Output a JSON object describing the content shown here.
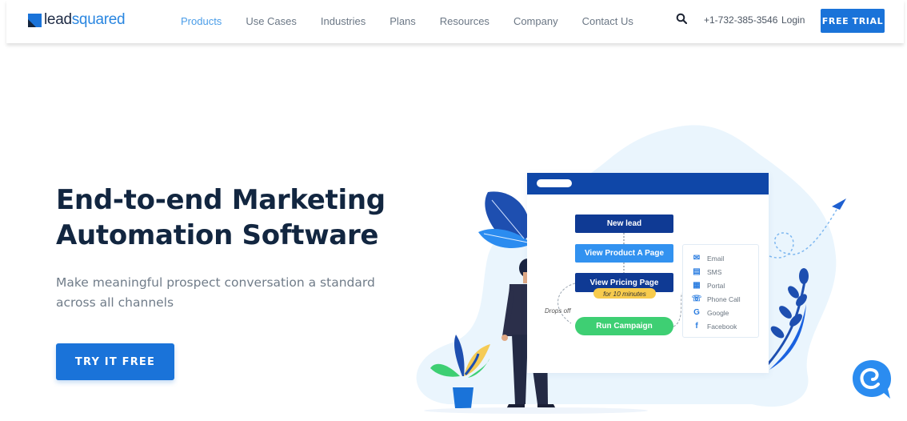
{
  "header": {
    "logo": {
      "part1": "lead",
      "part2": "squared"
    },
    "nav": [
      {
        "label": "Products",
        "active": true
      },
      {
        "label": "Use Cases"
      },
      {
        "label": "Industries"
      },
      {
        "label": "Plans"
      },
      {
        "label": "Resources"
      },
      {
        "label": "Company"
      },
      {
        "label": "Contact Us"
      }
    ],
    "phone": "+1-732-385-3546",
    "login": "Login",
    "free_trial": "FREE TRIAL"
  },
  "hero": {
    "title_line1": "End-to-end Marketing",
    "title_line2": "Automation Software",
    "subtitle_line1": "Make meaningful prospect conversation a standard",
    "subtitle_line2": "across all channels",
    "cta": "TRY IT FREE"
  },
  "illustration": {
    "flow": {
      "new_lead": "New lead",
      "view_product": "View Product A Page",
      "view_pricing": "View Pricing Page",
      "duration_badge": "for 10 minutes",
      "run_campaign": "Run Campaign",
      "drops_off": "Drops off"
    },
    "channels": [
      {
        "icon": "email-icon",
        "label": "Email"
      },
      {
        "icon": "sms-icon",
        "label": "SMS"
      },
      {
        "icon": "portal-icon",
        "label": "Portal"
      },
      {
        "icon": "phone-icon",
        "label": "Phone Call"
      },
      {
        "icon": "google-icon",
        "label": "Google"
      },
      {
        "icon": "facebook-icon",
        "label": "Facebook"
      }
    ]
  },
  "colors": {
    "brand_blue": "#1a73d9",
    "navy": "#0f3a94",
    "light_blue": "#3292f0",
    "green": "#3ecf73",
    "yellow": "#f7cb4d",
    "title": "#122640"
  }
}
